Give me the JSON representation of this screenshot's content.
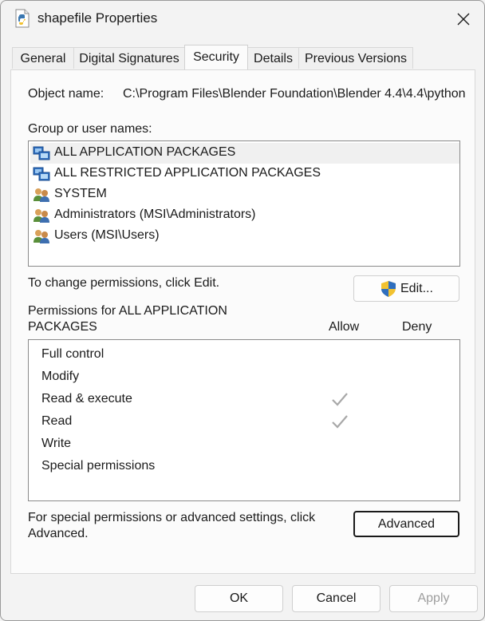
{
  "window": {
    "title": "shapefile Properties"
  },
  "tabs": [
    {
      "label": "General",
      "active": false
    },
    {
      "label": "Digital Signatures",
      "active": false
    },
    {
      "label": "Security",
      "active": true
    },
    {
      "label": "Details",
      "active": false
    },
    {
      "label": "Previous Versions",
      "active": false
    }
  ],
  "security": {
    "object_name_label": "Object name:",
    "object_name_value": "C:\\Program Files\\Blender Foundation\\Blender 4.4\\4.4\\python",
    "group_label": "Group or user names:",
    "groups": [
      {
        "name": "ALL APPLICATION PACKAGES",
        "icon": "app-packages-icon",
        "selected": true
      },
      {
        "name": "ALL RESTRICTED APPLICATION PACKAGES",
        "icon": "app-packages-icon",
        "selected": false
      },
      {
        "name": "SYSTEM",
        "icon": "users-icon",
        "selected": false
      },
      {
        "name": "Administrators (MSI\\Administrators)",
        "icon": "users-icon",
        "selected": false
      },
      {
        "name": "Users (MSI\\Users)",
        "icon": "users-icon",
        "selected": false
      }
    ],
    "change_text": "To change permissions, click Edit.",
    "edit_button": "Edit...",
    "permissions_for_line1": "Permissions for ALL APPLICATION",
    "permissions_for_line2": "PACKAGES",
    "allow_header": "Allow",
    "deny_header": "Deny",
    "permissions": [
      {
        "name": "Full control",
        "allow": false,
        "deny": false
      },
      {
        "name": "Modify",
        "allow": false,
        "deny": false
      },
      {
        "name": "Read & execute",
        "allow": true,
        "deny": false
      },
      {
        "name": "Read",
        "allow": true,
        "deny": false
      },
      {
        "name": "Write",
        "allow": false,
        "deny": false
      },
      {
        "name": "Special permissions",
        "allow": false,
        "deny": false
      }
    ],
    "advanced_text_line1": "For special permissions or advanced settings, click",
    "advanced_text_line2": "Advanced.",
    "advanced_button": "Advanced"
  },
  "footer": {
    "ok": "OK",
    "cancel": "Cancel",
    "apply": "Apply"
  },
  "colors": {
    "background": "#f3f3f3",
    "panel": "#fbfbfb",
    "check_gray": "#a8a8a8",
    "disabled_text": "#9e9e9e",
    "selected_row": "#f0f0f0"
  }
}
